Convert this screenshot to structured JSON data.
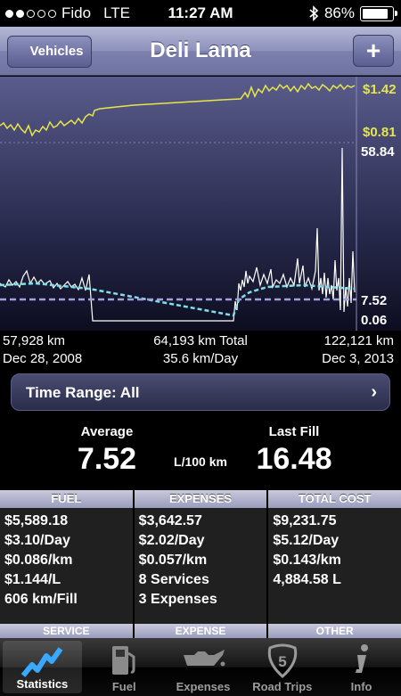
{
  "status_bar": {
    "carrier": "Fido",
    "network": "LTE",
    "time": "11:27 AM",
    "battery": "86%",
    "battery_level": 0.86,
    "signal_bars_filled": 2,
    "signal_bars_total": 5
  },
  "nav": {
    "back_label": "Vehicles",
    "title": "Deli Lama",
    "add_label": "+"
  },
  "chart": {
    "price_high": "$1.42",
    "price_low": "$0.81",
    "consumption_high": "58.84",
    "consumption_avg": "7.52",
    "consumption_low": "0.06",
    "colors": {
      "price": "#e6e64a",
      "consumption": "#ffffff",
      "trend": "#7fe0e8",
      "average": "#a0a0e0"
    }
  },
  "chart_summary": {
    "start_odometer": "57,928 km",
    "total_distance": "64,193 km Total",
    "end_odometer": "122,121 km",
    "start_date": "Dec 28, 2008",
    "per_day": "35.6 km/Day",
    "end_date": "Dec 3, 2013"
  },
  "time_range": {
    "label": "Time Range: All"
  },
  "averages": {
    "average_label": "Average",
    "average_value": "7.52",
    "unit": "L/100 km",
    "last_fill_label": "Last Fill",
    "last_fill_value": "16.48"
  },
  "stats": {
    "fuel": {
      "header": "FUEL",
      "rows": [
        "$5,589.18",
        "$3.10/Day",
        "$0.086/km",
        "$1.144/L",
        "606 km/Fill"
      ]
    },
    "expenses": {
      "header": "EXPENSES",
      "rows": [
        "$3,642.57",
        "$2.02/Day",
        "$0.057/km",
        "8 Services",
        "3 Expenses"
      ]
    },
    "total_cost": {
      "header": "TOTAL COST",
      "rows": [
        "$9,231.75",
        "$5.12/Day",
        "$0.143/km",
        "4,884.58 L"
      ]
    },
    "second_headers": [
      "SERVICE",
      "EXPENSE",
      "OTHER"
    ]
  },
  "tabs": [
    {
      "label": "Statistics",
      "icon": "statistics-icon",
      "active": true
    },
    {
      "label": "Fuel",
      "icon": "fuel-pump-icon",
      "active": false
    },
    {
      "label": "Expenses",
      "icon": "oil-can-icon",
      "active": false
    },
    {
      "label": "Road Trips",
      "icon": "highway-shield-icon",
      "active": false
    },
    {
      "label": "Info",
      "icon": "info-icon",
      "active": false
    }
  ]
}
